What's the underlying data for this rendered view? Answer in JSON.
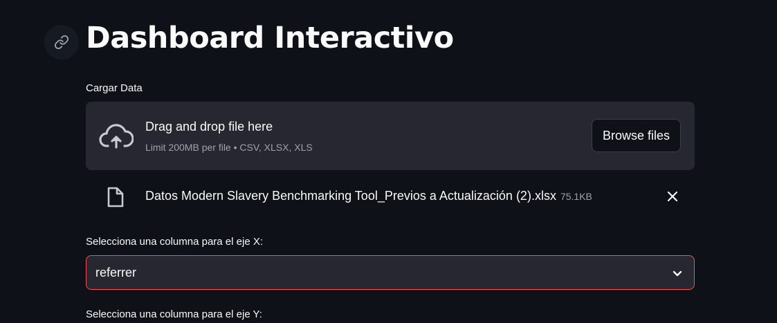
{
  "header": {
    "title": "Dashboard Interactivo",
    "anchor_icon": "link-icon"
  },
  "uploader": {
    "label": "Cargar Data",
    "dropzone_title": "Drag and drop file here",
    "dropzone_limit": "Limit 200MB per file • CSV, XLSX, XLS",
    "upload_icon": "cloud-upload-icon",
    "browse_label": "Browse files"
  },
  "uploaded_file": {
    "name": "Datos Modern Slavery Benchmarking Tool_Previos a Actualización (2).xlsx",
    "size": "75.1KB",
    "file_icon": "file-icon",
    "remove_icon": "close-icon"
  },
  "x_axis_select": {
    "label": "Selecciona una columna para el eje X:",
    "value": "referrer",
    "icon": "chevron-down-icon"
  },
  "y_axis_select": {
    "label": "Selecciona una columna para el eje Y:"
  },
  "colors": {
    "background": "#0e1117",
    "surface": "#262730",
    "text": "#fafafa",
    "muted_text": "#9ea3ad",
    "focus_border": "#ff4b4b"
  }
}
